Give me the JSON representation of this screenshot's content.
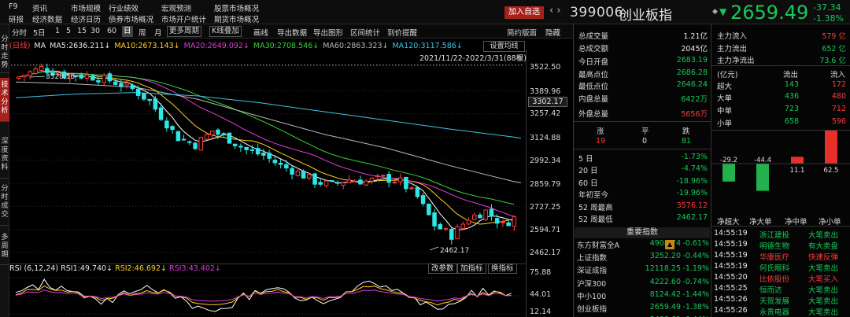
{
  "app": {
    "fkey": "F9"
  },
  "menu": {
    "row1": [
      "资讯",
      "市场规模",
      "行业绩效",
      "宏观预测",
      "股票市场概况"
    ],
    "row2": [
      "研报",
      "经济数据",
      "经济日历",
      "债券市场概况",
      "市场开户统计",
      "期货市场概况"
    ]
  },
  "header": {
    "add_watch": "加入自选",
    "nav": "‹ ›",
    "code": "399006",
    "name": "创业板指",
    "price": "2659.49",
    "change": "-37.34",
    "change_pct": "-1.38%"
  },
  "vtabs": [
    "分时走势",
    "技术分析",
    "深度资料",
    "分时成交",
    "多周期"
  ],
  "toolbar": {
    "items": [
      "分时",
      "5日",
      "1",
      "5",
      "15",
      "30",
      "60",
      "日",
      "周",
      "月",
      "更多周期",
      "K线叠加",
      "画线",
      "导出数据",
      "导出图形",
      "区间统计",
      "到价提醒",
      "简约版面",
      "隐藏"
    ],
    "active": "日"
  },
  "ma_legend": {
    "label": "(日线)",
    "ma": "MA",
    "ma5": "MA5:2636.211↓",
    "ma10": "MA10:2673.143↓",
    "ma20": "MA20:2649.092↓",
    "ma30": "MA30:2708.546↓",
    "ma60": "MA60:2863.323↓",
    "ma120": "MA120:3117.586↓"
  },
  "chart": {
    "setting": "设置均线",
    "range_text": "2021/11/22-2022/3/31(88根)",
    "high_label": "3528.50",
    "low_label": "2462.17",
    "axis_labels": [
      "3522.50",
      "3389.96",
      "3257.42",
      "3124.88",
      "2992.34",
      "2859.79",
      "2727.25",
      "2594.71",
      "2462.17"
    ],
    "marker": "3302.17"
  },
  "rsi": {
    "title": "RSI (6,12,24)",
    "rsi1": "RSI1:49.740↓",
    "rsi2": "RSI2:46.692↓",
    "rsi3": "RSI3:43.402↓",
    "buttons": [
      "改参数",
      "加指标",
      "换指标"
    ],
    "axis": [
      "75.88",
      "44.01",
      "12.14"
    ]
  },
  "quote": {
    "left": [
      {
        "label": "总成交量",
        "value": "1.21亿"
      },
      {
        "label": "总成交额",
        "value": "2045亿"
      },
      {
        "label": "今日开盘",
        "value": "2683.19"
      },
      {
        "label": "最高点位",
        "value": "2686.28"
      },
      {
        "label": "最低点位",
        "value": "2646.24"
      },
      {
        "label": "内盘总量",
        "value": "6422万"
      },
      {
        "label": "外盘总量",
        "value": "5656万"
      }
    ],
    "zdp_labels": [
      "涨",
      "平",
      "跌"
    ],
    "zdp_values": [
      "19",
      "0",
      "81"
    ],
    "periods": [
      {
        "label": "5 日",
        "value": "-1.73%"
      },
      {
        "label": "20 日",
        "value": "-4.74%"
      },
      {
        "label": "60 日",
        "value": "-18.96%"
      },
      {
        "label": "年初至今",
        "value": "-19.96%"
      },
      {
        "label": "52 周最高",
        "value": "3576.12"
      },
      {
        "label": "52 周最低",
        "value": "2462.17"
      }
    ]
  },
  "flow": {
    "rows": [
      {
        "label": "主力流入",
        "value": "579 亿"
      },
      {
        "label": "主力流出",
        "value": "652 亿"
      },
      {
        "label": "主力净流出",
        "value": "73.6 亿"
      }
    ],
    "head": [
      "(亿元)",
      "流出",
      "流入"
    ],
    "orders": [
      {
        "label": "超大",
        "out": "143",
        "in": "172"
      },
      {
        "label": "大单",
        "out": "436",
        "in": "480"
      },
      {
        "label": "中单",
        "out": "723",
        "in": "712"
      },
      {
        "label": "小单",
        "out": "658",
        "in": "596"
      }
    ],
    "bars": [
      {
        "label": "净超大",
        "value": -29.2,
        "text": "-29.2"
      },
      {
        "label": "净大单",
        "value": -44.4,
        "text": "-44.4"
      },
      {
        "label": "净中单",
        "value": 11.1,
        "text": "11.1"
      },
      {
        "label": "净小单",
        "value": 62.5,
        "text": "62.5"
      }
    ]
  },
  "indices": {
    "title": "重要指数",
    "rows": [
      {
        "name": "东方财富全A",
        "value": "4908.74",
        "pct": "-0.61%"
      },
      {
        "name": "上证指数",
        "value": "3252.20",
        "pct": "-0.44%"
      },
      {
        "name": "深证成指",
        "value": "12118.25",
        "pct": "-1.19%"
      },
      {
        "name": "沪深300",
        "value": "4222.60",
        "pct": "-0.74%"
      },
      {
        "name": "中小100",
        "value": "8124.42",
        "pct": "-1.44%"
      },
      {
        "name": "创业板指",
        "value": "2659.49",
        "pct": "-1.38%"
      },
      {
        "name": "A股指数",
        "value": "3408.61",
        "pct": "-0.44%"
      }
    ]
  },
  "ticks": [
    {
      "time": "14:55:19",
      "name": "浙江建投",
      "type": "大笔卖出",
      "color": "#19c85a"
    },
    {
      "time": "14:55:19",
      "name": "明德生物",
      "type": "有大卖盘",
      "color": "#19c85a"
    },
    {
      "time": "14:55:19",
      "name": "华康医疗",
      "type": "快速反弹",
      "color": "#ff3b3b"
    },
    {
      "time": "14:55:19",
      "name": "何氏眼科",
      "type": "大笔卖出",
      "color": "#19c85a"
    },
    {
      "time": "14:55:20",
      "name": "比依股份",
      "type": "大笔买入",
      "color": "#ff3b3b"
    },
    {
      "time": "14:55:25",
      "name": "恒而达",
      "type": "大笔卖出",
      "color": "#19c85a"
    },
    {
      "time": "14:55:26",
      "name": "天贺发展",
      "type": "大笔卖出",
      "color": "#19c85a"
    },
    {
      "time": "14:55:26",
      "name": "永贵电器",
      "type": "大笔卖出",
      "color": "#19c85a"
    }
  ],
  "colors": {
    "up": "#ff3b3b",
    "down": "#19c85a",
    "ma5": "#ffffff",
    "ma10": "#ffd21e",
    "ma20": "#e43ad9",
    "ma30": "#3ad03a",
    "ma60": "#b8b8b8",
    "ma120": "#3ec3e6"
  }
}
